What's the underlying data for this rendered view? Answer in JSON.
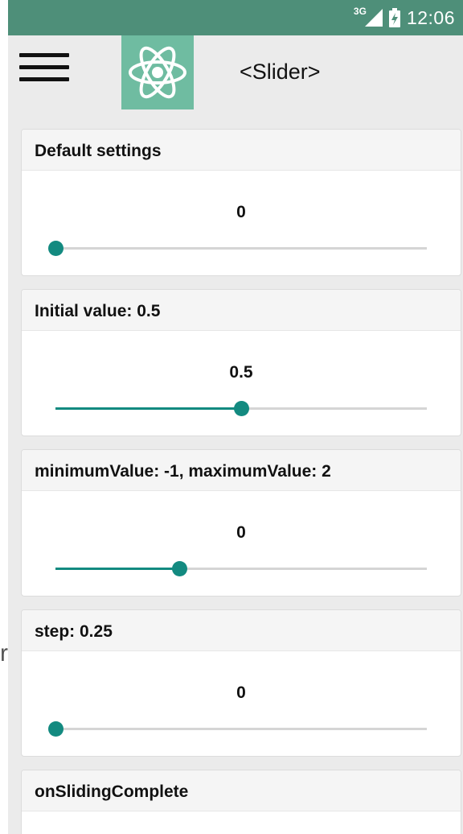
{
  "status_bar": {
    "network": "3G",
    "time": "12:06",
    "icons": [
      "signal-icon",
      "battery-icon"
    ],
    "color": "#4e8f79"
  },
  "toolbar": {
    "menu_icon": "hamburger-menu-icon",
    "logo_icon": "react-logo-icon",
    "title": "<Slider>"
  },
  "stray_char": "r",
  "accent_color": "#138a80",
  "sections": [
    {
      "title": "Default settings",
      "value_label": "0",
      "fraction": 0
    },
    {
      "title": "Initial value: 0.5",
      "value_label": "0.5",
      "fraction": 0.5
    },
    {
      "title": "minimumValue: -1, maximumValue: 2",
      "value_label": "0",
      "fraction": 0.3333
    },
    {
      "title": "step: 0.25",
      "value_label": "0",
      "fraction": 0
    },
    {
      "title": "onSlidingComplete"
    }
  ]
}
